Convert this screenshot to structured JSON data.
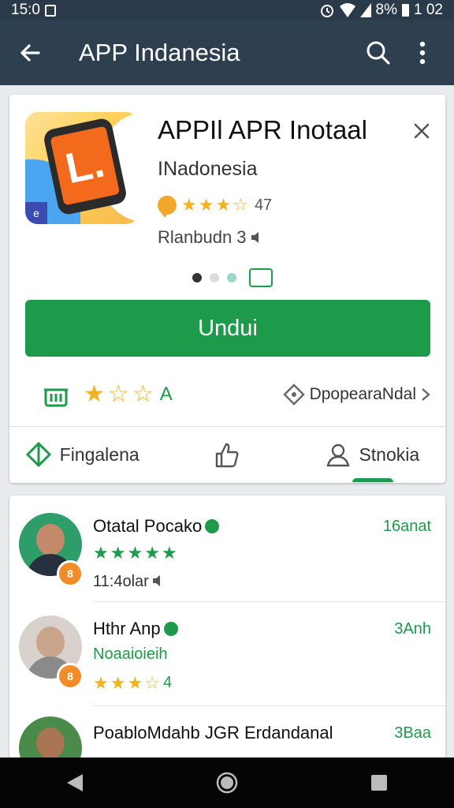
{
  "status": {
    "time": "15:0",
    "battery": "8%",
    "clock_right": "1 02"
  },
  "appbar": {
    "title": "APP Indanesia"
  },
  "app": {
    "name": "APPIl APR Inotaal",
    "developer": "INadonesia",
    "rating": "47",
    "downloads": "Rlanbudn 3",
    "icon_letter": "L.",
    "icon_mini": "e",
    "install_label": "Undui",
    "grade": "A",
    "meta_right": "DpopearaNdal"
  },
  "tabs": [
    {
      "label": "Fingalena"
    },
    {
      "label": ""
    },
    {
      "label": "Stnokia"
    }
  ],
  "reviews": [
    {
      "name": "Otatal Pocako",
      "time": "16anat",
      "line2": "11:4olar",
      "stars": 5,
      "badge": "8",
      "style": "green"
    },
    {
      "name": "Hthr Anp",
      "time": "3Anh",
      "line2": "Noaaioieih",
      "stars_value": "4",
      "badge": "8",
      "style": "gold"
    },
    {
      "name": "PoabloMdahb JGR Erdandanal",
      "time": "3Baa"
    }
  ],
  "colors": {
    "appbar": "#2e3f50",
    "accent": "#1d9b4a",
    "star": "#f2b320"
  }
}
